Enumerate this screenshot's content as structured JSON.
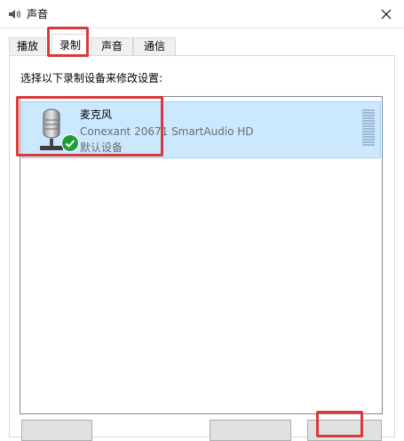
{
  "window": {
    "title": "声音",
    "title_icon": "speaker-icon",
    "close_icon": "close-icon"
  },
  "tabs": [
    {
      "label": "播放",
      "active": false
    },
    {
      "label": "录制",
      "active": true
    },
    {
      "label": "声音",
      "active": false
    },
    {
      "label": "通信",
      "active": false
    }
  ],
  "instruction": "选择以下录制设备来修改设置:",
  "devices": [
    {
      "name": "麦克风",
      "driver": "Conexant 20671 SmartAudio HD",
      "status": "默认设备",
      "icon": "microphone-icon",
      "badge_icon": "checkmark-icon",
      "selected": true
    }
  ],
  "colors": {
    "highlight_annotation": "#d63a3a",
    "selection_background": "#cce8ff",
    "check_badge": "#1e9e3b"
  }
}
